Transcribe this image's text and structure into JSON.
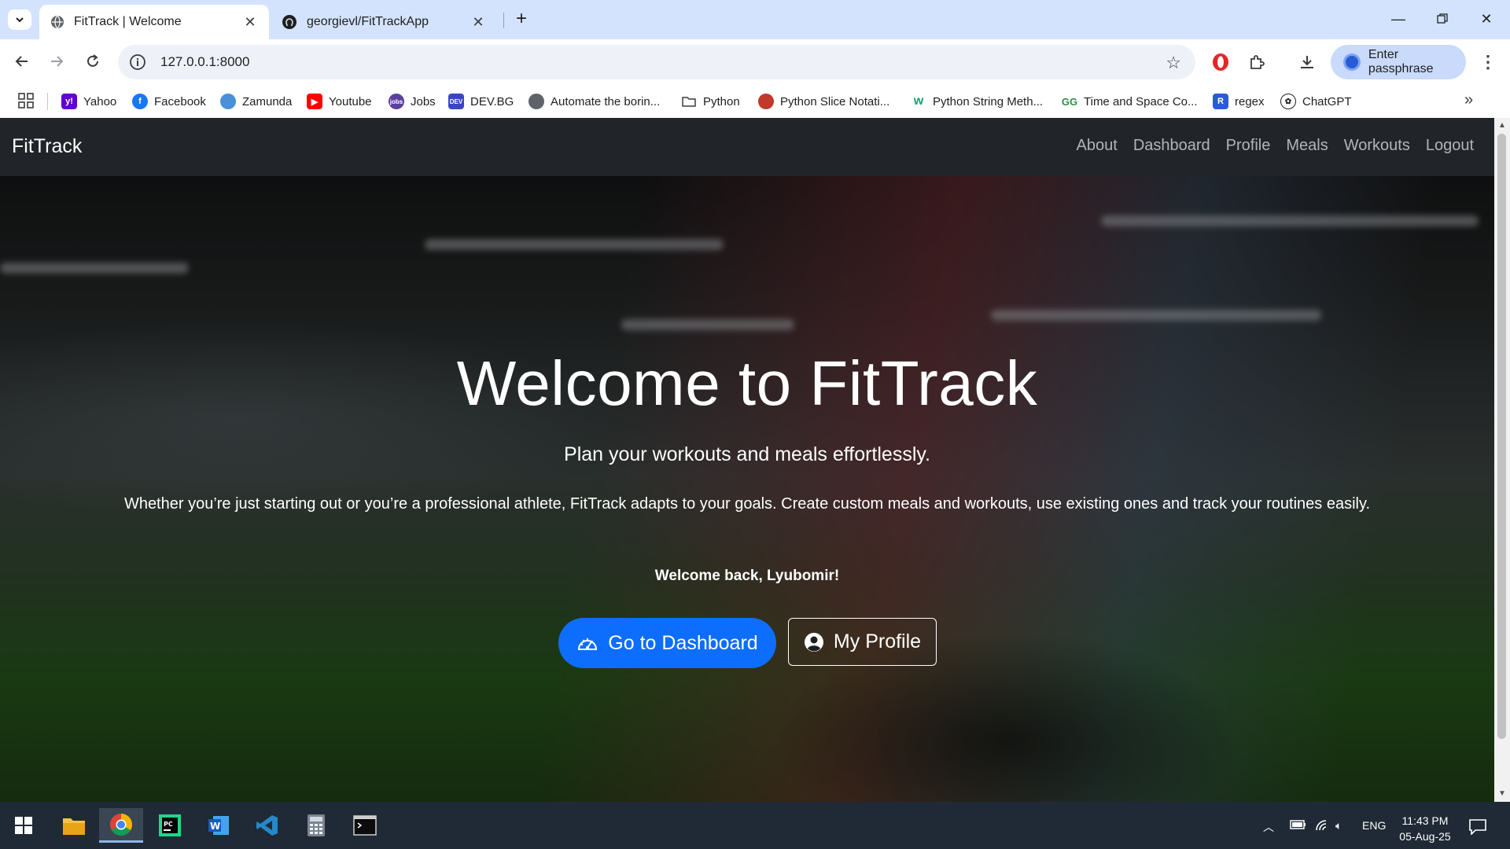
{
  "browser": {
    "tabs": [
      {
        "title": "FitTrack | Welcome",
        "active": true,
        "icon": "globe-icon"
      },
      {
        "title": "georgievl/FitTrackApp",
        "active": false,
        "icon": "github-icon"
      }
    ],
    "url": "127.0.0.1:8000",
    "profile_button": "Enter passphrase",
    "bookmarks": [
      {
        "label": "Yahoo",
        "icon": "yahoo-icon",
        "color": "#6001d2"
      },
      {
        "label": "Facebook",
        "icon": "facebook-icon",
        "color": "#1877f2"
      },
      {
        "label": "Zamunda",
        "icon": "zamunda-icon",
        "color": "#4a90d9"
      },
      {
        "label": "Youtube",
        "icon": "youtube-icon",
        "color": "#ff0000"
      },
      {
        "label": "Jobs",
        "icon": "jobs-icon",
        "color": "#5b3fa0"
      },
      {
        "label": "DEV.BG",
        "icon": "devbg-icon",
        "color": "#3b45c4"
      },
      {
        "label": "Automate the borin...",
        "icon": "globe-icon",
        "color": "#5f6368"
      },
      {
        "label": "Python",
        "icon": "folder-icon",
        "color": "#5f6368"
      },
      {
        "label": "Python Slice Notati...",
        "icon": "slice-icon",
        "color": "#c0392b"
      },
      {
        "label": "Python String Meth...",
        "icon": "w3schools-icon",
        "color": "#04aa6d"
      },
      {
        "label": "Time and Space Co...",
        "icon": "gfg-icon",
        "color": "#2f8d46"
      },
      {
        "label": "regex",
        "icon": "regex-icon",
        "color": "#2a5bd7"
      },
      {
        "label": "ChatGPT",
        "icon": "chatgpt-icon",
        "color": "#1f1f1f"
      }
    ]
  },
  "site": {
    "brand": "FitTrack",
    "nav": [
      "About",
      "Dashboard",
      "Profile",
      "Meals",
      "Workouts",
      "Logout"
    ],
    "hero": {
      "title": "Welcome to FitTrack",
      "lead": "Plan your workouts and meals effortlessly.",
      "description": "Whether you’re just starting out or you’re a professional athlete, FitTrack adapts to your goals. Create custom meals and workouts, use existing ones and track your routines easily.",
      "welcome": "Welcome back, Lyubomir!",
      "primary_button": "Go to Dashboard",
      "secondary_button": "My Profile",
      "primary_color": "#0d6efd"
    }
  },
  "taskbar": {
    "apps": [
      "windows-start-icon",
      "file-explorer-icon",
      "chrome-icon",
      "pycharm-icon",
      "word-icon",
      "vscode-icon",
      "calculator-icon",
      "terminal-icon"
    ],
    "language": "ENG",
    "time": "11:43 PM",
    "date": "05-Aug-25"
  }
}
